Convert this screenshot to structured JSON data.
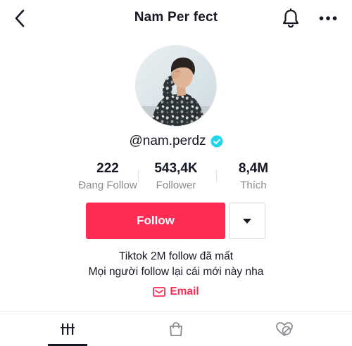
{
  "header": {
    "title": "Nam Per fect"
  },
  "profile": {
    "handle": "@nam.perdz",
    "verified": true,
    "avatar_icon": "profile-photo"
  },
  "stats": [
    {
      "value": "222",
      "label": "Đang Follow"
    },
    {
      "value": "543,4K",
      "label": "Follower"
    },
    {
      "value": "8,4M",
      "label": "Thích"
    }
  ],
  "actions": {
    "follow_label": "Follow",
    "dropdown_icon": "caret-down-icon"
  },
  "bio": {
    "line1": "Tiktok 2M follow đã mất",
    "line2": "Mọi người follow lại cái mới này nha"
  },
  "email": {
    "label": "Email",
    "icon": "mail-icon"
  },
  "tabs": [
    {
      "icon": "videos-grid-icon",
      "active": true
    },
    {
      "icon": "shopping-bag-icon",
      "active": false
    },
    {
      "icon": "liked-hidden-icon",
      "active": false
    }
  ],
  "colors": {
    "accent": "#fe2c55",
    "verified": "#20d5ec",
    "text": "#161823",
    "secondary": "#8a8b91"
  }
}
